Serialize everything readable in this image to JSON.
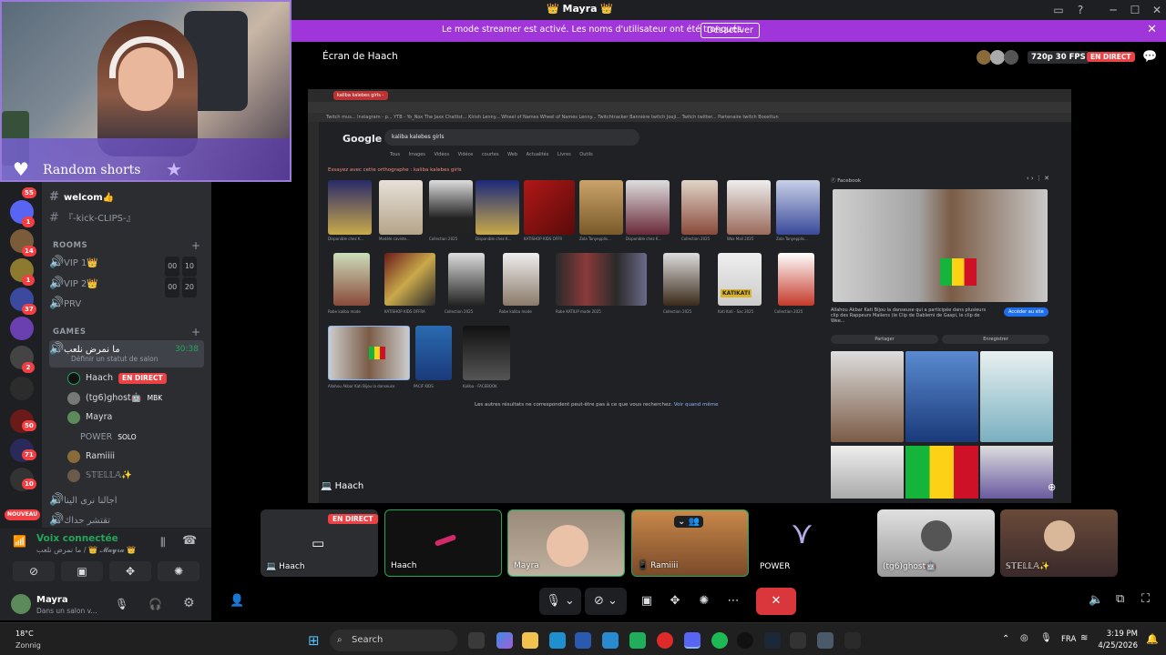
{
  "app": {
    "title": "👑 Mayra 👑"
  },
  "banner": {
    "text": "Le mode streamer est activé. Les noms d'utilisateur ont été tronqués.",
    "button": "Désactiver"
  },
  "webcam": {
    "label": "Random shorts"
  },
  "guild_badges": [
    "55",
    "1",
    "14",
    "1",
    "1",
    "37",
    "2",
    "1",
    "50",
    "71",
    "10",
    "NOUVEAU"
  ],
  "channels": {
    "text": [
      {
        "name": "welcom👍"
      },
      {
        "name": "『-kick-CLIPS-』"
      }
    ],
    "rooms_label": "ROOMS",
    "rooms": [
      {
        "name": "VIP 1👑",
        "count_a": "00",
        "count_b": "10"
      },
      {
        "name": "VIP 2👑",
        "count_a": "00",
        "count_b": "20"
      },
      {
        "name": "PRV"
      }
    ],
    "games_label": "GAMES",
    "active_channel": {
      "name": "ما نمرض نلعب",
      "time": "30:38",
      "status": "Définir un statut de salon"
    },
    "members": [
      {
        "name": "Haach",
        "live": "EN DIRECT"
      },
      {
        "name": "(tg6)ghost🤖",
        "tag": "MBK"
      },
      {
        "name": "Mayra"
      },
      {
        "name": "POWER",
        "tag": "SOLO"
      },
      {
        "name": "Ramiiii"
      },
      {
        "name": "𝕊𝕋𝔼𝕃𝕃𝔸✨"
      }
    ],
    "extra": [
      {
        "name": "اجالنا نرى الينا"
      },
      {
        "name": "تقتشر حداك"
      }
    ]
  },
  "voice": {
    "status": "Voix connectée",
    "sub": "ما نمرض نلعب / 👑 𝓜𝓪𝔂𝓻𝓪 👑",
    "user": "Mayra",
    "user_sub": "Dans un salon v..."
  },
  "stream": {
    "title": "Écran de Haach",
    "quality": "720p 30 FPS",
    "live": "EN DIRECT",
    "screen_user": "Haach"
  },
  "browser": {
    "tab": "kaliba kalebes girls - Ann",
    "bookmarks": "Twitch mus...  Instagram - p...  YTB - Yo_Nox  The Jaxx Chatlist...  Kirish  Lenny...  Wheel of Names  Wheel of Names  Lenny...  Twitchtracker  Bannière twitch  Jooji...  Twitch twitter...  Partenaire twitch  Boosttun",
    "google": "Google",
    "query": "kaliba kalebes girls",
    "tabs": "Tous Images Vidéos Vidéos courtes Web Actualités Livres Outils",
    "suggest": "Essayez avec cette orthographe : kaliba kalebes girls",
    "no_results": "Les autres résultats ne correspondent peut-être pas à ce que vous recherchez.",
    "no_results_link": "Voir quand même",
    "captions": [
      "Disponible chez K...",
      "Modèle caviste...",
      "Collection 2025",
      "Disponible chez K...",
      "KATISHOP KIDS OFFR",
      "Zola Tanyepplis...",
      "Disponible chez K...",
      "Collection 2025",
      "Wax Mali 2025",
      "Zola Tanyepplis...",
      "Robe kaliba mode",
      "KATISHOP KIDS OFFRA",
      "Collection 2025",
      "Robe kaliba mode",
      "Robe KATILIP mode 2025",
      "Collection 2025",
      "Kati Kati - Sac 2025",
      "Collection 2025",
      "Allahou Akbar Kati Bijou la danseuse",
      "PACIF KIDS",
      "Kaliba - FACEBOOK"
    ],
    "fb_source": "Facebook",
    "fb_desc": "Allahou Akbar Kati Bijou la danseuse qui a participée dans plusieurs clip des Rappeurs Maliens (le Clip de Dablemi de Gaspi, le clip de Wee...",
    "fb_visit": "Accéder au site",
    "fb_share": "Partager",
    "fb_save": "Enregistrer",
    "katikati": "KATIKATI"
  },
  "tiles": [
    {
      "name": "Haach",
      "live": "EN DIRECT"
    },
    {
      "name": "Haach"
    },
    {
      "name": "Mayra"
    },
    {
      "name": "Ramiiii"
    },
    {
      "name": "POWER"
    },
    {
      "name": "(tg6)ghost🤖"
    },
    {
      "name": "𝕊𝕋𝔼𝕃𝕃𝔸✨"
    }
  ],
  "taskbar": {
    "temp": "18°C",
    "weather": "Zonnig",
    "search": "Search",
    "lang": "FRA",
    "time": "3:19 PM",
    "date": "4/25/2026"
  },
  "colors": {
    "accent": "#a035d9",
    "live": "#ed4245",
    "online": "#23a55a",
    "end_call": "#da373c"
  }
}
